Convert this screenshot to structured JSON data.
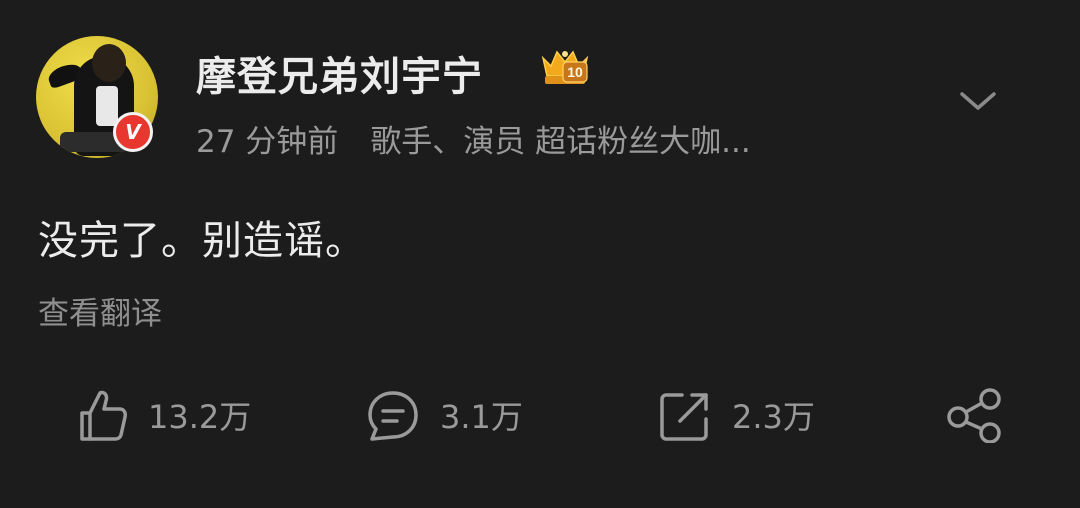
{
  "post": {
    "username": "摩登兄弟刘宇宁",
    "badge_level": "10",
    "verified_mark": "V",
    "time": "27 分钟前",
    "description": "歌手、演员 超话粉丝大咖...",
    "content": "没完了。别造谣。",
    "translate_label": "查看翻译"
  },
  "actions": {
    "like_count": "13.2万",
    "comment_count": "3.1万",
    "repost_count": "2.3万"
  },
  "icons": {
    "avatar": "avatar-photo",
    "verified": "verified-badge-icon",
    "badge": "fan-level-crown-badge",
    "dropdown": "chevron-down-icon",
    "like": "thumbs-up-icon",
    "comment": "comment-bubble-icon",
    "repost": "repost-icon",
    "share": "share-icon"
  },
  "colors": {
    "background": "#1c1c1c",
    "primary_text": "#ececec",
    "secondary_text": "#9a9a9a",
    "verified_red": "#e8372e",
    "badge_gold": "#f2a91c"
  }
}
